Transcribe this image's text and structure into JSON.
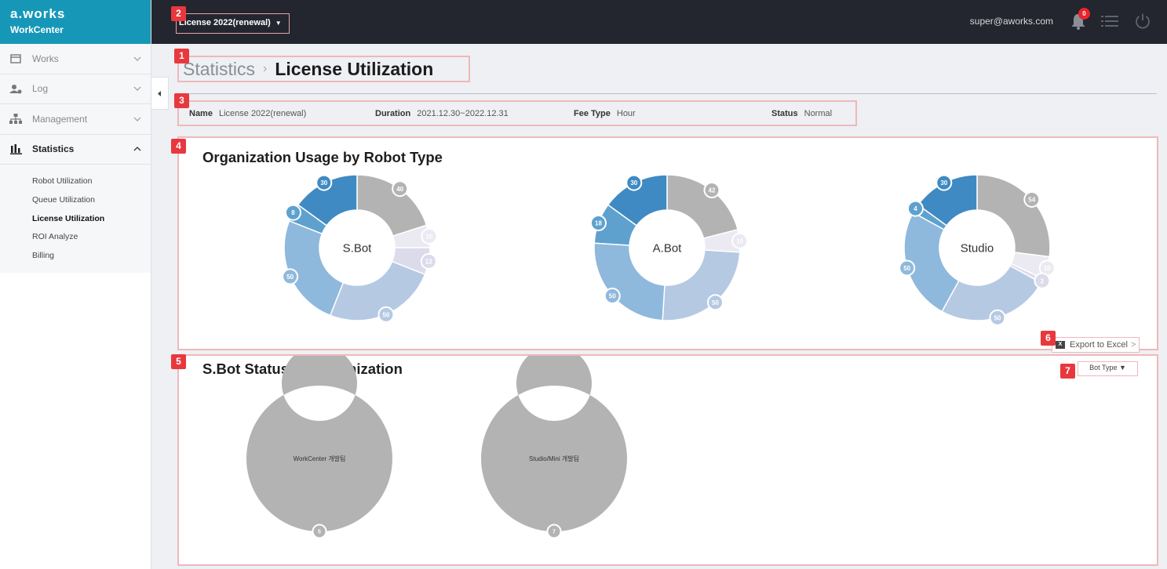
{
  "app": {
    "brand": "a.works",
    "product": "WorkCenter"
  },
  "topbar": {
    "license_select": "License 2022(renewal)",
    "user_email": "super@aworks.com",
    "notification_count": "0"
  },
  "sidebar": {
    "items": [
      {
        "label": "Works",
        "icon": "calendar-icon"
      },
      {
        "label": "Log",
        "icon": "user-log-icon"
      },
      {
        "label": "Management",
        "icon": "org-tree-icon"
      },
      {
        "label": "Statistics",
        "icon": "bar-chart-icon"
      }
    ],
    "sub_items": [
      {
        "label": "Robot Utilization",
        "active": false
      },
      {
        "label": "Queue Utilization",
        "active": false
      },
      {
        "label": "License Utilization",
        "active": true
      },
      {
        "label": "ROI Analyze",
        "active": false
      },
      {
        "label": "Billing",
        "active": false
      }
    ]
  },
  "breadcrumb": {
    "parent": "Statistics",
    "separator": "›",
    "current": "License Utilization"
  },
  "license_info": {
    "name_label": "Name",
    "name_value": "License 2022(renewal)",
    "duration_label": "Duration",
    "duration_value": "2021.12.30~2022.12.31",
    "fee_label": "Fee Type",
    "fee_value": "Hour",
    "status_label": "Status",
    "status_value": "Normal"
  },
  "markers": [
    "1",
    "2",
    "3",
    "4",
    "5",
    "6",
    "7"
  ],
  "org_usage": {
    "title": "Organization Usage by Robot Type",
    "export_label": "Export to Excel",
    "export_arrow": ">"
  },
  "sbot_status": {
    "title": "S.Bot Status by Organization",
    "bot_type_label": "Bot Type"
  },
  "colors": {
    "topbar": "#23262e",
    "logo": "#1797b8",
    "marker": "#e8383d",
    "highlight": "#efb8bc",
    "seg_dark_blue": "#3f8ac2",
    "seg_mid_blue": "#5ea1cf",
    "seg_light_blue": "#8fb9dc",
    "seg_pale_blue": "#b5c9e3",
    "seg_gray": "#b3b3b3",
    "seg_lavender": "#e4e3ef"
  },
  "chart_data": [
    {
      "type": "pie",
      "center_label": "S.Bot",
      "segments": [
        {
          "value": 40,
          "color": "#b3b3b3"
        },
        {
          "value": 10,
          "color": "#ebe9f1"
        },
        {
          "value": 12,
          "color": "#dcdbeb"
        },
        {
          "value": 50,
          "color": "#b5c9e3"
        },
        {
          "value": 50,
          "color": "#8fb9dc"
        },
        {
          "value": 8,
          "color": "#5ea1cf"
        },
        {
          "value": 30,
          "color": "#3f8ac2"
        }
      ]
    },
    {
      "type": "pie",
      "center_label": "A.Bot",
      "segments": [
        {
          "value": 42,
          "color": "#b3b3b3"
        },
        {
          "value": 10,
          "color": "#ebe9f1"
        },
        {
          "value": 50,
          "color": "#b5c9e3"
        },
        {
          "value": 50,
          "color": "#8fb9dc"
        },
        {
          "value": 18,
          "color": "#5ea1cf"
        },
        {
          "value": 30,
          "color": "#3f8ac2"
        }
      ]
    },
    {
      "type": "pie",
      "center_label": "Studio",
      "segments": [
        {
          "value": 54,
          "color": "#b3b3b3"
        },
        {
          "value": 10,
          "color": "#ebe9f1"
        },
        {
          "value": 2,
          "color": "#dcdbeb"
        },
        {
          "value": 50,
          "color": "#b5c9e3"
        },
        {
          "value": 50,
          "color": "#8fb9dc"
        },
        {
          "value": 4,
          "color": "#5ea1cf"
        },
        {
          "value": 30,
          "color": "#3f8ac2"
        }
      ]
    },
    {
      "type": "pie",
      "center_label": "WorkCenter 개발팀",
      "segments": [
        {
          "value": 5,
          "color": "#b3b3b3"
        }
      ]
    },
    {
      "type": "pie",
      "center_label": "Studio/Mini 개발팀",
      "segments": [
        {
          "value": 7,
          "color": "#b3b3b3"
        }
      ]
    }
  ]
}
